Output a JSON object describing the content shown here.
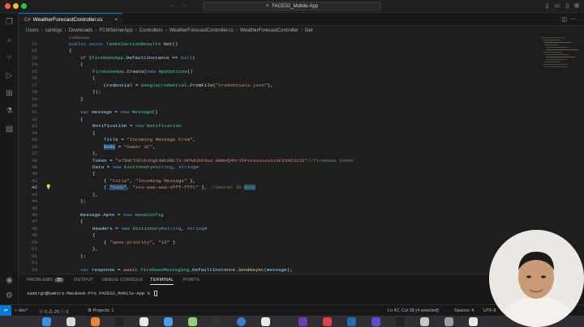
{
  "titlebar": {
    "search_text": "FACES2_Mobile-App",
    "search_icon": "search-icon"
  },
  "tab": {
    "label": "WeatherForecastController.cs",
    "icon_text": "C#",
    "close": "×"
  },
  "breadcrumb": {
    "items": [
      "Users",
      "samirgc",
      "Downloads",
      "FCMServerApp",
      "Controllers",
      "WeatherForecastController.cs",
      "WeatherForecastController",
      "Get"
    ],
    "sep": "›"
  },
  "code": {
    "refs": "0 references",
    "line_numbers": [
      "21",
      "22",
      "23",
      "24",
      "25",
      "26",
      "27",
      "28",
      "29",
      "30",
      "31",
      "32",
      "33",
      "34",
      "35",
      "36",
      "37",
      "38",
      "39",
      "40",
      "41",
      "42",
      "43",
      "44",
      "45",
      "46",
      "47",
      "48",
      "49",
      "50",
      "51",
      "52",
      "53",
      "54"
    ],
    "active_line": "42",
    "l21": [
      "public ",
      "async ",
      "Task",
      "<",
      "IActionResult",
      "> ",
      "Get",
      "()"
    ],
    "l22": "{",
    "l23": [
      "if ",
      "(",
      "FirebaseApp",
      ".",
      "DefaultInstance",
      " == ",
      "null",
      ")"
    ],
    "l24": "{",
    "l25": [
      "FirebaseApp",
      ".",
      "Create",
      "(",
      "new ",
      "AppOptions",
      "()"
    ],
    "l26": "{",
    "l27": [
      "Credential",
      " = ",
      "GoogleCredential",
      ".",
      "FromFile",
      "(",
      "\"credentials.json\"",
      "),"
    ],
    "l28": "});",
    "l29": "}",
    "l30": "",
    "l31": [
      "var ",
      "message",
      " = ",
      "new ",
      "Message",
      "()"
    ],
    "l32": "{",
    "l33": [
      "Notification",
      " = ",
      "new ",
      "Notification"
    ],
    "l34": "{",
    "l35": [
      "Title",
      " = ",
      "\"Incoming Message From\"",
      ","
    ],
    "l36": [
      "Body",
      " = ",
      "\"Samir GC\"",
      ","
    ],
    "l37": "},",
    "l38": [
      "Token",
      " = ",
      "\"e75mCTSF1kVngC4Wt0BLTs:APA91bFduz-9mNvQ4VrihFxxssssxzxxxF23423232\"",
      "//firebase token"
    ],
    "l39": [
      "Data",
      " = ",
      "new ",
      "Dictionary",
      "<",
      "string",
      ", ",
      "string",
      ">"
    ],
    "l40": "{",
    "l41": [
      "{ ",
      "\"title\"",
      ", ",
      "\"Incoming Message\"",
      " },"
    ],
    "l42": [
      "{ ",
      "\"body\"",
      ", ",
      "\"xxx-aaa-aaa-dfff-fffC\"",
      " }, ",
      "//secret ID ",
      "Body"
    ],
    "l43": "},",
    "l44": "};",
    "l45": "",
    "l46": [
      "message",
      ".",
      "Apns",
      " = ",
      "new ",
      "ApnsConfig"
    ],
    "l47": "{",
    "l48": [
      "Headers",
      " = ",
      "new ",
      "Dictionary",
      "<",
      "string",
      ", ",
      "string",
      ">"
    ],
    "l49": "{",
    "l50": [
      "{ ",
      "\"apns-priority\"",
      ", ",
      "\"10\"",
      " }"
    ],
    "l51": "},",
    "l52": "};",
    "l53": "",
    "l54": [
      "var ",
      "response",
      " = ",
      "await ",
      "FirebaseMessaging",
      ".",
      "DefaultInstance",
      ".",
      "SendAsync",
      "(",
      "message",
      ");"
    ]
  },
  "panel": {
    "tabs": [
      "PROBLEMS",
      "OUTPUT",
      "DEBUG CONSOLE",
      "TERMINAL",
      "PORTS"
    ],
    "problems_count": "25",
    "active_tab": "TERMINAL",
    "prompt": "samirgc@Samirs-MacBook-Pro FACES2_Mobile-App % "
  },
  "statusbar": {
    "branch": "dev*",
    "errors": "0",
    "warnings": "25",
    "info": "0",
    "projects": "Projects: 1",
    "position": "Ln 42, Col 28 (4 selected)",
    "spaces": "Spaces: 4",
    "encoding": "UTF-8"
  }
}
